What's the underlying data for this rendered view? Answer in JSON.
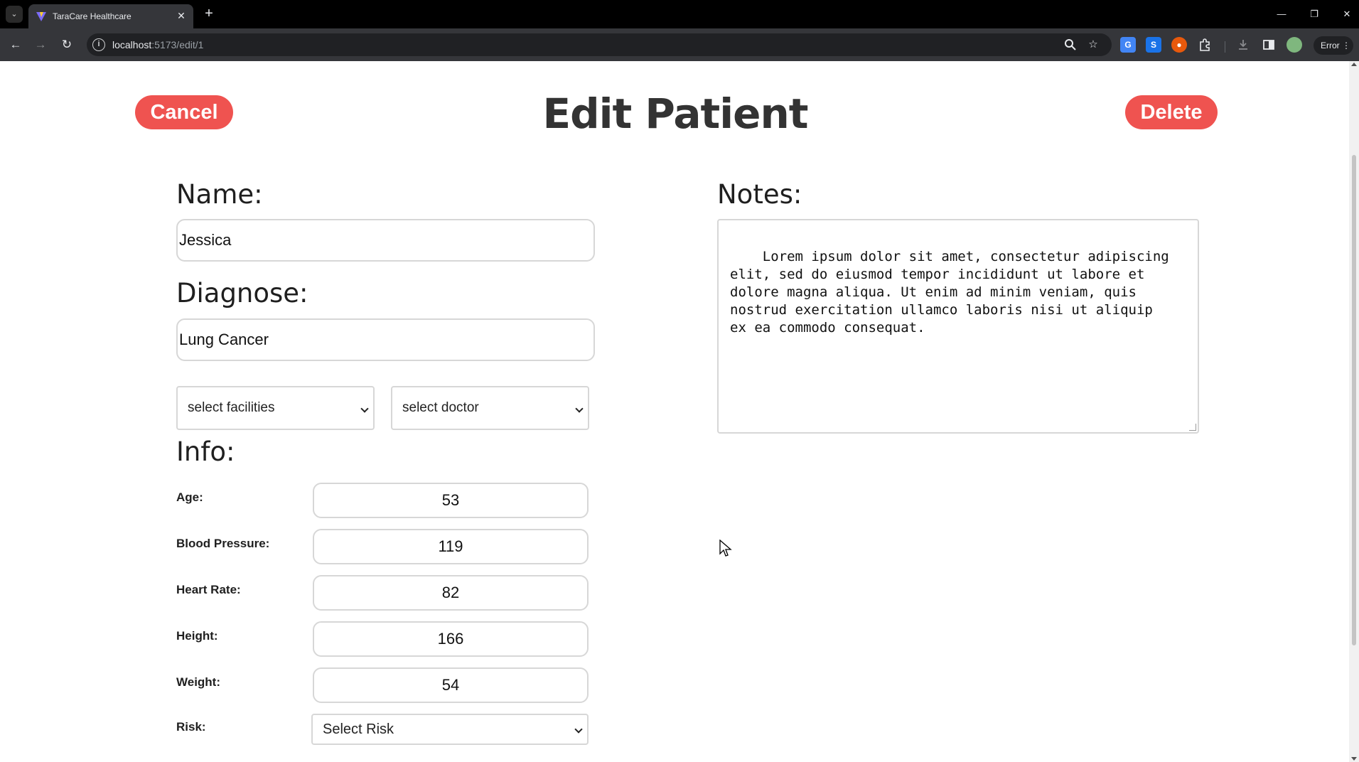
{
  "browser": {
    "tab_title": "TaraCare Healthcare",
    "url_host": "localhost",
    "url_path": ":5173/edit/1",
    "profile_status": "Error",
    "controls": {
      "minimize": "—",
      "restore": "❐",
      "close": "✕"
    }
  },
  "page": {
    "title": "Edit Patient",
    "cancel_label": "Cancel",
    "delete_label": "Delete",
    "accent_color": "#ef5350"
  },
  "form": {
    "name_label": "Name:",
    "name_value": "Jessica",
    "diagnose_label": "Diagnose:",
    "diagnose_value": "Lung Cancer",
    "facilities_selected": "select facilities",
    "doctor_selected": "select doctor",
    "info_label": "Info:",
    "info": [
      {
        "label": "Age:",
        "value": "53"
      },
      {
        "label": "Blood Pressure:",
        "value": "119"
      },
      {
        "label": "Heart Rate:",
        "value": "82"
      },
      {
        "label": "Height:",
        "value": "166"
      },
      {
        "label": "Weight:",
        "value": "54"
      }
    ],
    "risk_label": "Risk:",
    "risk_selected": "Select Risk",
    "notes_label": "Notes:",
    "notes_value": "Lorem ipsum dolor sit amet, consectetur adipiscing\nelit, sed do eiusmod tempor incididunt ut labore et\ndolore magna aliqua. Ut enim ad minim veniam, quis\nnostrud exercitation ullamco laboris nisi ut aliquip\nex ea commodo consequat."
  }
}
